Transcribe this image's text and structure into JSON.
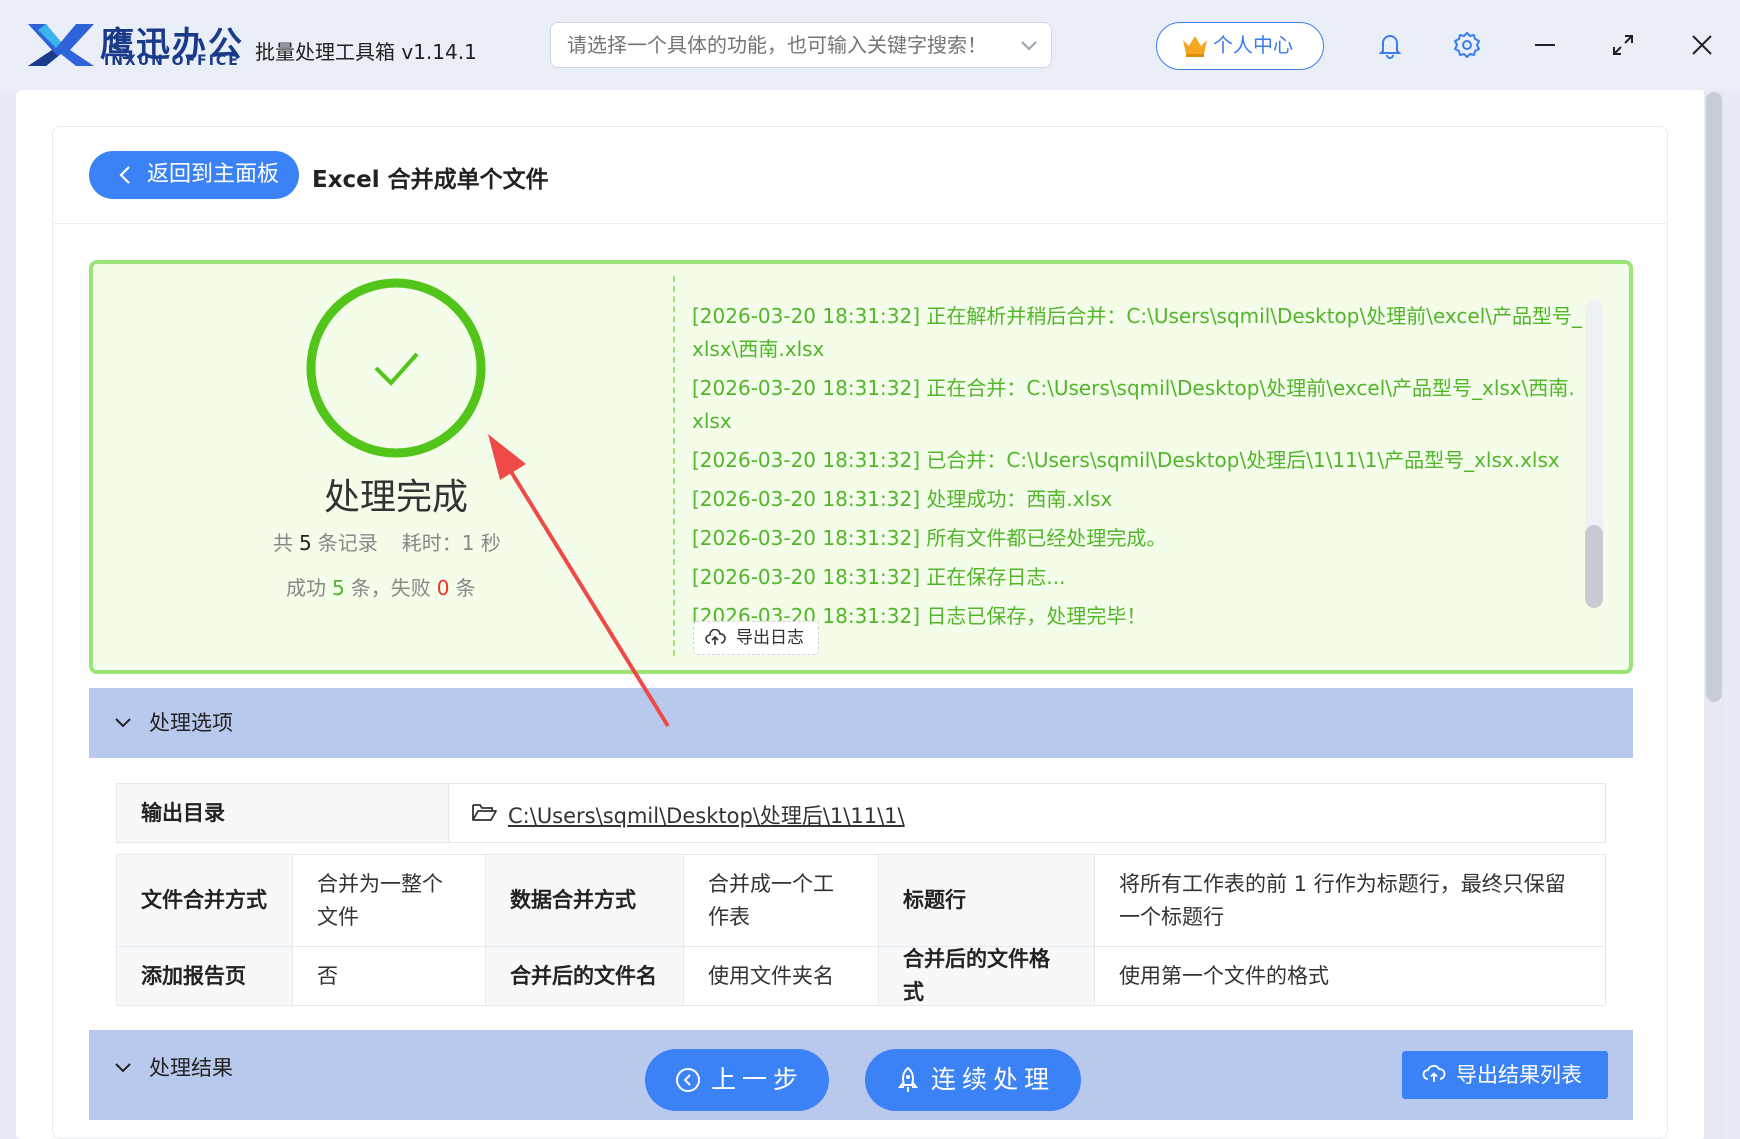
{
  "app": {
    "brand_cn": "鹰迅办公",
    "brand_en": "INXUN OFFICE",
    "title": "批量处理工具箱 v1.14.1",
    "search_placeholder": "请选择一个具体的功能，也可输入关键字搜索！",
    "user_center_label": "个人中心",
    "accent_color": "#3b82f6"
  },
  "header": {
    "back_label": "返回到主面板",
    "page_title": "Excel 合并成单个文件"
  },
  "result": {
    "status_title": "处理完成",
    "total_prefix": "共",
    "total_count": "5",
    "total_suffix": "条记录",
    "time_label": "耗时：",
    "time_value": "1 秒",
    "success_prefix": "成功",
    "success_count": "5",
    "success_suffix": "条，失败",
    "fail_count": "0",
    "fail_suffix": "条",
    "status_color": "#52b52a"
  },
  "log": {
    "lines": [
      "[2026-03-20 18:31:32] 正在解析并稍后合并：C:\\Users\\sqmil\\Desktop\\处理前\\excel\\产品型号_xlsx\\西南.xlsx",
      "[2026-03-20 18:31:32] 正在合并：C:\\Users\\sqmil\\Desktop\\处理前\\excel\\产品型号_xlsx\\西南.xlsx",
      "[2026-03-20 18:31:32] 已合并：C:\\Users\\sqmil\\Desktop\\处理后\\1\\11\\1\\产品型号_xlsx.xlsx",
      "[2026-03-20 18:31:32] 处理成功：西南.xlsx",
      "[2026-03-20 18:31:32] 所有文件都已经处理完成。",
      "[2026-03-20 18:31:32] 正在保存日志...",
      "[2026-03-20 18:31:32] 日志已保存，处理完毕！"
    ],
    "export_label": "导出日志"
  },
  "options": {
    "section_title": "处理选项",
    "output_dir_label": "输出目录",
    "output_dir_value": "C:\\Users\\sqmil\\Desktop\\处理后\\1\\11\\1\\",
    "merge_mode_label": "文件合并方式",
    "merge_mode_value": "合并为一整个文件",
    "data_merge_label": "数据合并方式",
    "data_merge_value": "合并成一个工作表",
    "header_row_label": "标题行",
    "header_row_value": "将所有工作表的前 1 行作为标题行，最终只保留一个标题行",
    "report_page_label": "添加报告页",
    "report_page_value": "否",
    "merged_name_label": "合并后的文件名",
    "merged_name_value": "使用文件夹名",
    "merged_format_label": "合并后的文件格式",
    "merged_format_value": "使用第一个文件的格式"
  },
  "results_section": {
    "section_title": "处理结果"
  },
  "footer": {
    "prev_label": "上一步",
    "continue_label": "连续处理",
    "export_list_label": "导出结果列表"
  }
}
